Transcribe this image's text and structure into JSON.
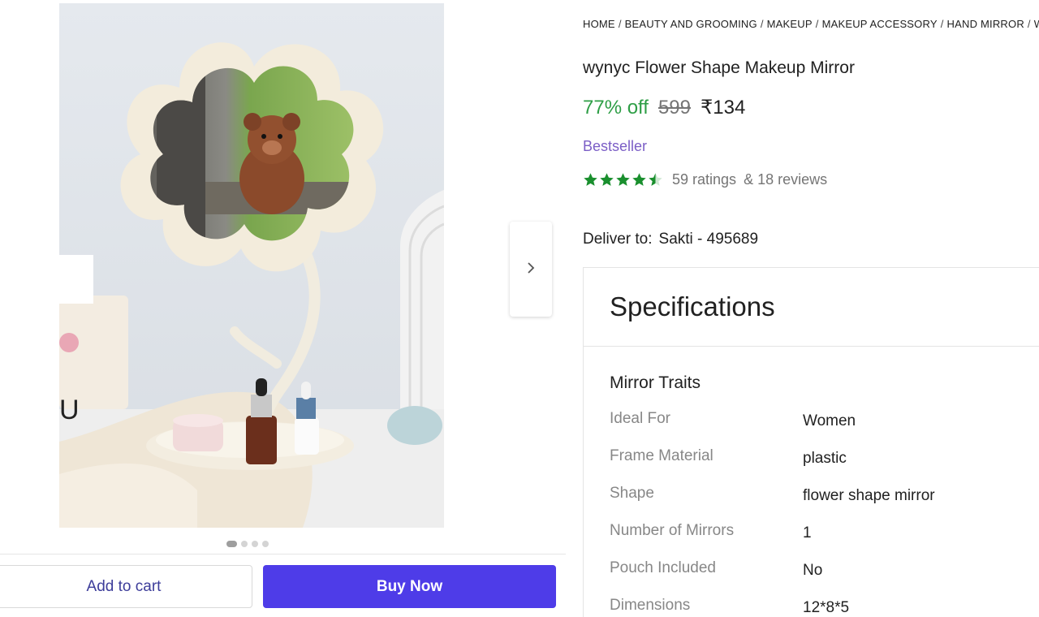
{
  "breadcrumb": [
    {
      "label": "HOME"
    },
    {
      "label": "BEAUTY AND GROOMING"
    },
    {
      "label": "MAKEUP"
    },
    {
      "label": "MAKEUP ACCESSORY"
    },
    {
      "label": "HAND MIRROR"
    },
    {
      "label": "W"
    }
  ],
  "product": {
    "title": "wynyc Flower Shape Makeup Mirror",
    "discount": "77% off",
    "mrp": "599",
    "price": "₹134",
    "badge": "Bestseller",
    "rating_value": 4.5,
    "ratings_text": "59 ratings",
    "reviews_text": "& 18 reviews"
  },
  "delivery": {
    "label": "Deliver to:",
    "location": "Sakti - 495689"
  },
  "specifications": {
    "title": "Specifications",
    "section_title": "Mirror Traits",
    "rows": [
      {
        "key": "Ideal For",
        "value": "Women"
      },
      {
        "key": "Frame Material",
        "value": "plastic"
      },
      {
        "key": "Shape",
        "value": "flower shape mirror"
      },
      {
        "key": "Number of Mirrors",
        "value": "1"
      },
      {
        "key": "Pouch Included",
        "value": "No"
      },
      {
        "key": "Dimensions",
        "value": "12*8*5"
      }
    ]
  },
  "gallery": {
    "dot_count": 4,
    "active_dot": 0,
    "next_icon": "chevron-right-icon"
  },
  "actions": {
    "add_to_cart": "Add to cart",
    "buy_now": "Buy Now"
  },
  "colors": {
    "discount": "#2e9e46",
    "bestseller": "#7b5ec6",
    "star": "#1a8f2e",
    "buy_button": "#4e3ce8"
  }
}
